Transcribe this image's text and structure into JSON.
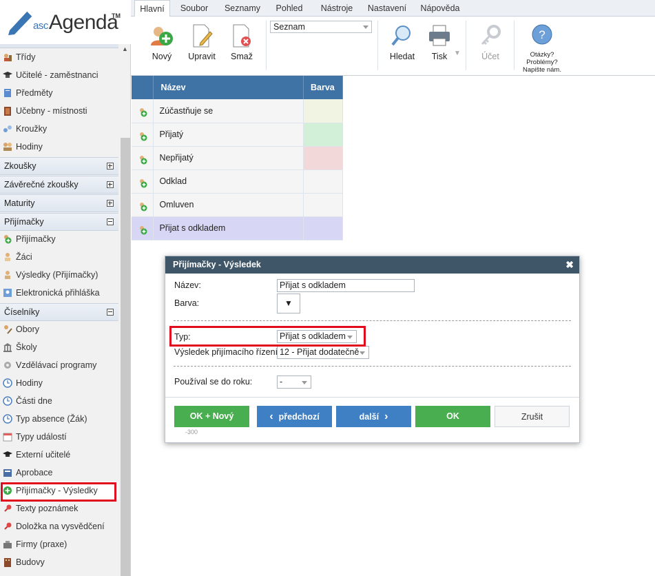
{
  "logo": {
    "asc": "asc",
    "name": "Agenda",
    "tm": "TM"
  },
  "menu": {
    "tabs": [
      {
        "label": "Hlavní",
        "active": true
      },
      {
        "label": "Soubor"
      },
      {
        "label": "Seznamy"
      },
      {
        "label": "Pohled"
      },
      {
        "label": "Nástroje"
      },
      {
        "label": "Nastavení"
      },
      {
        "label": "Nápověda"
      }
    ]
  },
  "toolbar": {
    "new_label": "Nový",
    "edit_label": "Upravit",
    "delete_label": "Smaž",
    "list_select": "Seznam",
    "search_label": "Hledat",
    "print_label": "Tisk",
    "account_label": "Účet",
    "help_line1": "Otázky?",
    "help_line2": "Problémy?",
    "help_line3": "Napište nám."
  },
  "sidebar": {
    "items": [
      {
        "label": "Třídy",
        "icon": "class-icon"
      },
      {
        "label": "Učitelé - zaměstnanci",
        "icon": "teacher-icon"
      },
      {
        "label": "Předměty",
        "icon": "subject-icon"
      },
      {
        "label": "Učebny - místnosti",
        "icon": "room-icon"
      },
      {
        "label": "Kroužky",
        "icon": "club-icon"
      },
      {
        "label": "Hodiny",
        "icon": "people-icon"
      }
    ],
    "sections": {
      "zkousky": "Zkoušky",
      "zaverecne": "Závěrečné zkoušky",
      "maturity": "Maturity",
      "prijimacky": "Přijímačky",
      "ciselniky": "Číselníky"
    },
    "prijimacky_items": [
      {
        "label": "Přijímačky"
      },
      {
        "label": "Žáci"
      },
      {
        "label": "Výsledky (Přijímačky)"
      },
      {
        "label": "Elektronická přihláška"
      }
    ],
    "ciselniky_items": [
      {
        "label": "Obory"
      },
      {
        "label": "Školy"
      },
      {
        "label": "Vzdělávací programy"
      },
      {
        "label": "Hodiny"
      },
      {
        "label": "Části dne"
      },
      {
        "label": "Typ absence (Žák)"
      },
      {
        "label": "Typy událostí"
      },
      {
        "label": "Externí učitelé"
      },
      {
        "label": "Aprobace"
      },
      {
        "label": "Přijímačky - Výsledky",
        "active": true
      },
      {
        "label": "Texty poznámek"
      },
      {
        "label": "Doložka na vysvědčení"
      },
      {
        "label": "Firmy (praxe)"
      },
      {
        "label": "Budovy"
      }
    ]
  },
  "grid": {
    "headers": {
      "name": "Název",
      "color": "Barva"
    },
    "rows": [
      {
        "name": "Zúčastňuje se",
        "color": "#f2f4e3"
      },
      {
        "name": "Přijatý",
        "color": "#d2efd8"
      },
      {
        "name": "Nepřijatý",
        "color": "#f3d8da"
      },
      {
        "name": "Odklad",
        "color": ""
      },
      {
        "name": "Omluven",
        "color": ""
      },
      {
        "name": "Přijat s odkladem",
        "color": "",
        "selected": true
      }
    ]
  },
  "dialog": {
    "title": "Přijímačky - Výsledek",
    "name_label": "Název:",
    "name_value": "Přijat s odkladem",
    "color_label": "Barva:",
    "type_label": "Typ:",
    "type_value": "Přijat s odkladem",
    "result_label": "Výsledek přijímacího řízení:",
    "result_value": "12 - Přijat dodatečně",
    "used_label": "Používal se do roku:",
    "used_value": "-",
    "small_note": "-300",
    "buttons": {
      "ok_new": "OK + Nový",
      "prev": "předchozí",
      "next": "další",
      "ok": "OK",
      "cancel": "Zrušit"
    }
  },
  "colors": {
    "accent": "#3f73a6",
    "dialog_header": "#3f5668",
    "green": "#49ae4f",
    "blue": "#3f7fc3",
    "highlight": "#e00b1c"
  }
}
